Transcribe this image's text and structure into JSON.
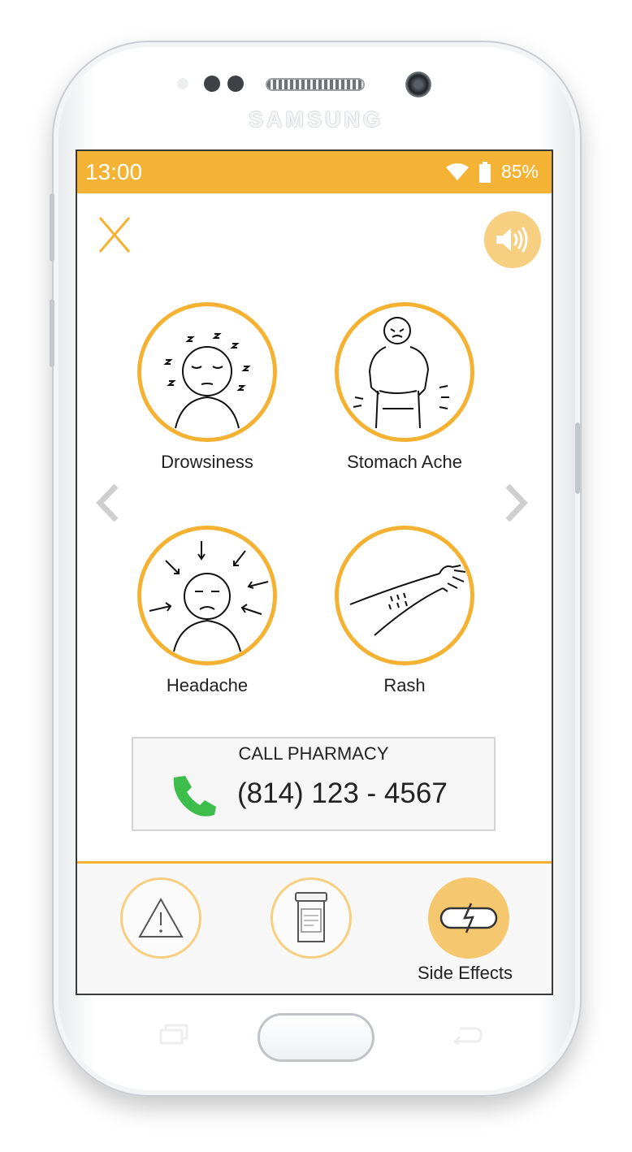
{
  "device": {
    "brand": "SAMSUNG"
  },
  "status_bar": {
    "time": "13:00",
    "battery_percent": "85%",
    "wifi_icon": "wifi-icon",
    "battery_icon": "battery-icon",
    "color": "#F5B335"
  },
  "header": {
    "close_label": "X",
    "sound_icon": "speaker-icon"
  },
  "symptoms": [
    {
      "label": "Drowsiness",
      "icon": "drowsiness-sketch"
    },
    {
      "label": "Stomach Ache",
      "icon": "stomach-ache-sketch"
    },
    {
      "label": "Headache",
      "icon": "headache-sketch"
    },
    {
      "label": "Rash",
      "icon": "rash-sketch"
    }
  ],
  "navigation": {
    "prev_icon": "chevron-left-icon",
    "next_icon": "chevron-right-icon"
  },
  "call_pharmacy": {
    "title": "CALL PHARMACY",
    "phone": "(814) 123 - 4567",
    "icon": "phone-icon"
  },
  "tabs": [
    {
      "icon": "warning-icon",
      "label": ""
    },
    {
      "icon": "pill-bottle-icon",
      "label": ""
    },
    {
      "icon": "pill-side-effects-icon",
      "label": "Side Effects",
      "active": true
    }
  ],
  "colors": {
    "accent": "#F4B132",
    "accent_light": "#F7CF81",
    "call_green": "#3DBE4C"
  }
}
